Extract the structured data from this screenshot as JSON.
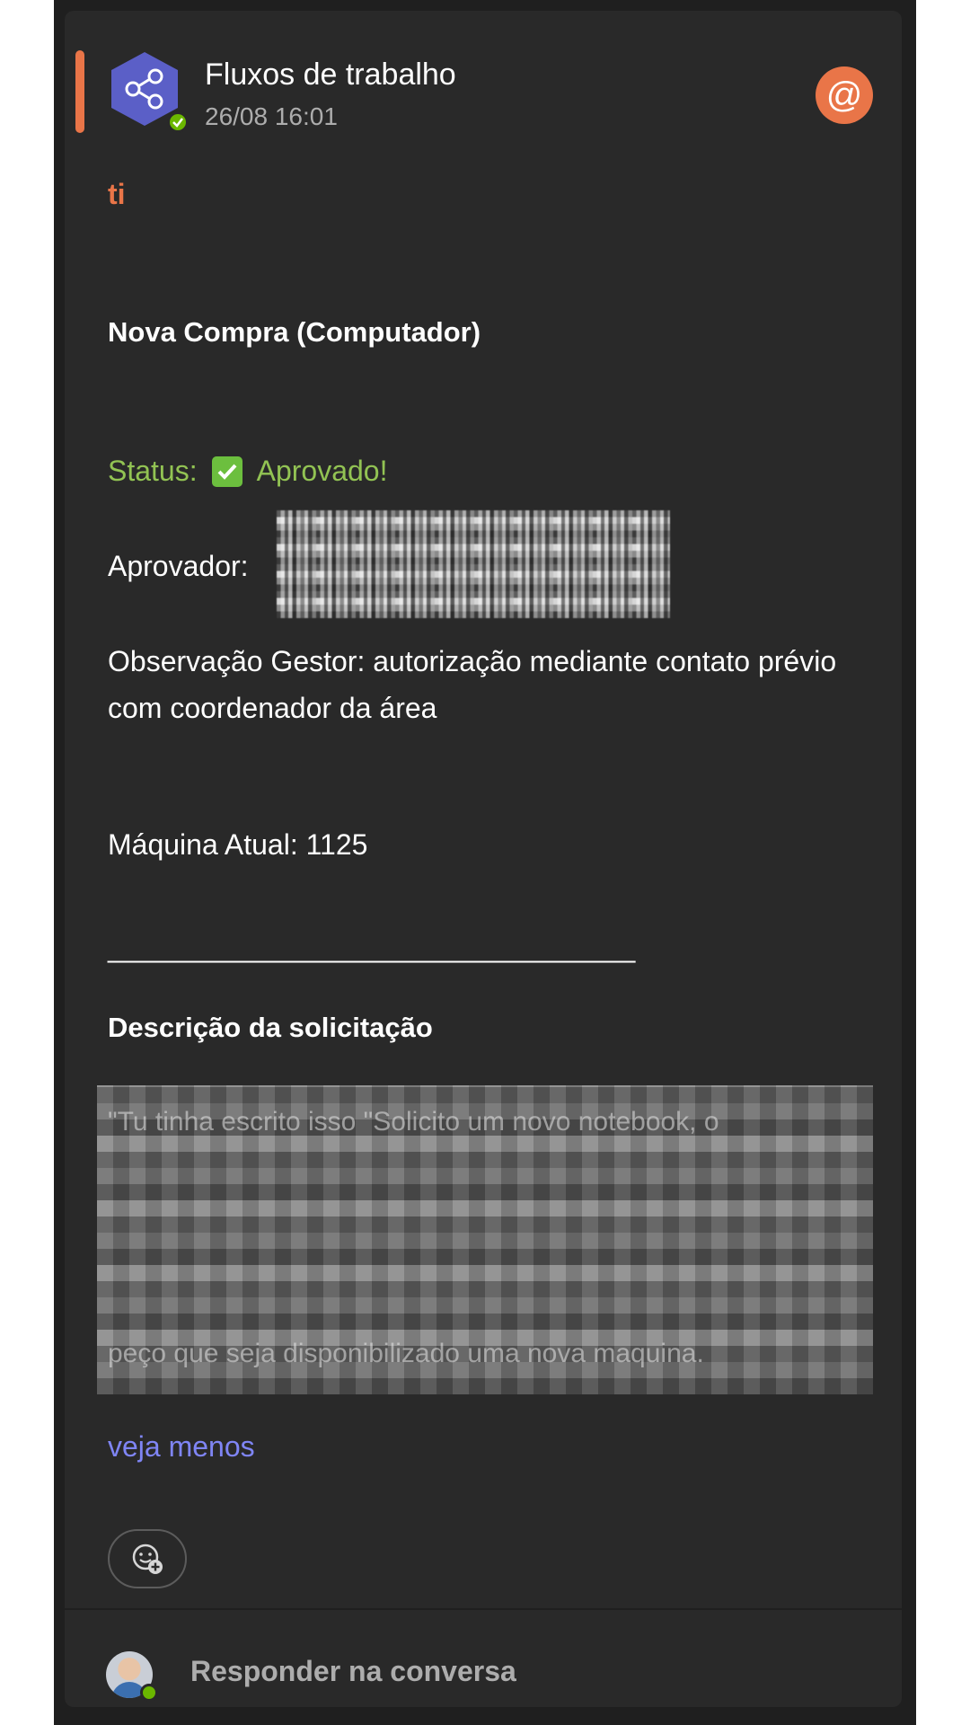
{
  "message": {
    "sender": "Fluxos de trabalho",
    "timestamp": "26/08 16:01",
    "mention_icon": "at-mention-icon",
    "mention": "ti",
    "title": "Nova Compra (Computador)",
    "status_label": "Status:",
    "status_value": "Aprovado!",
    "approver_label": "Aprovador:",
    "observation": "Observação Gestor: autorização mediante contato prévio com coordenador da área",
    "machine": "Máquina Atual: 1125",
    "separator": "_________________________________",
    "description_title": "Descrição da solicitação",
    "description_first": "\"Tu tinha escrito isso \"Solicito um novo notebook, o",
    "description_last": "peço que seja disponibilizado uma nova maquina.",
    "see_less": "veja menos"
  },
  "reply": {
    "placeholder": "Responder na conversa"
  },
  "colors": {
    "accent": "#e97548",
    "status_green": "#92c353",
    "link": "#7f85f5",
    "bot_avatar": "#5b5fc7"
  }
}
